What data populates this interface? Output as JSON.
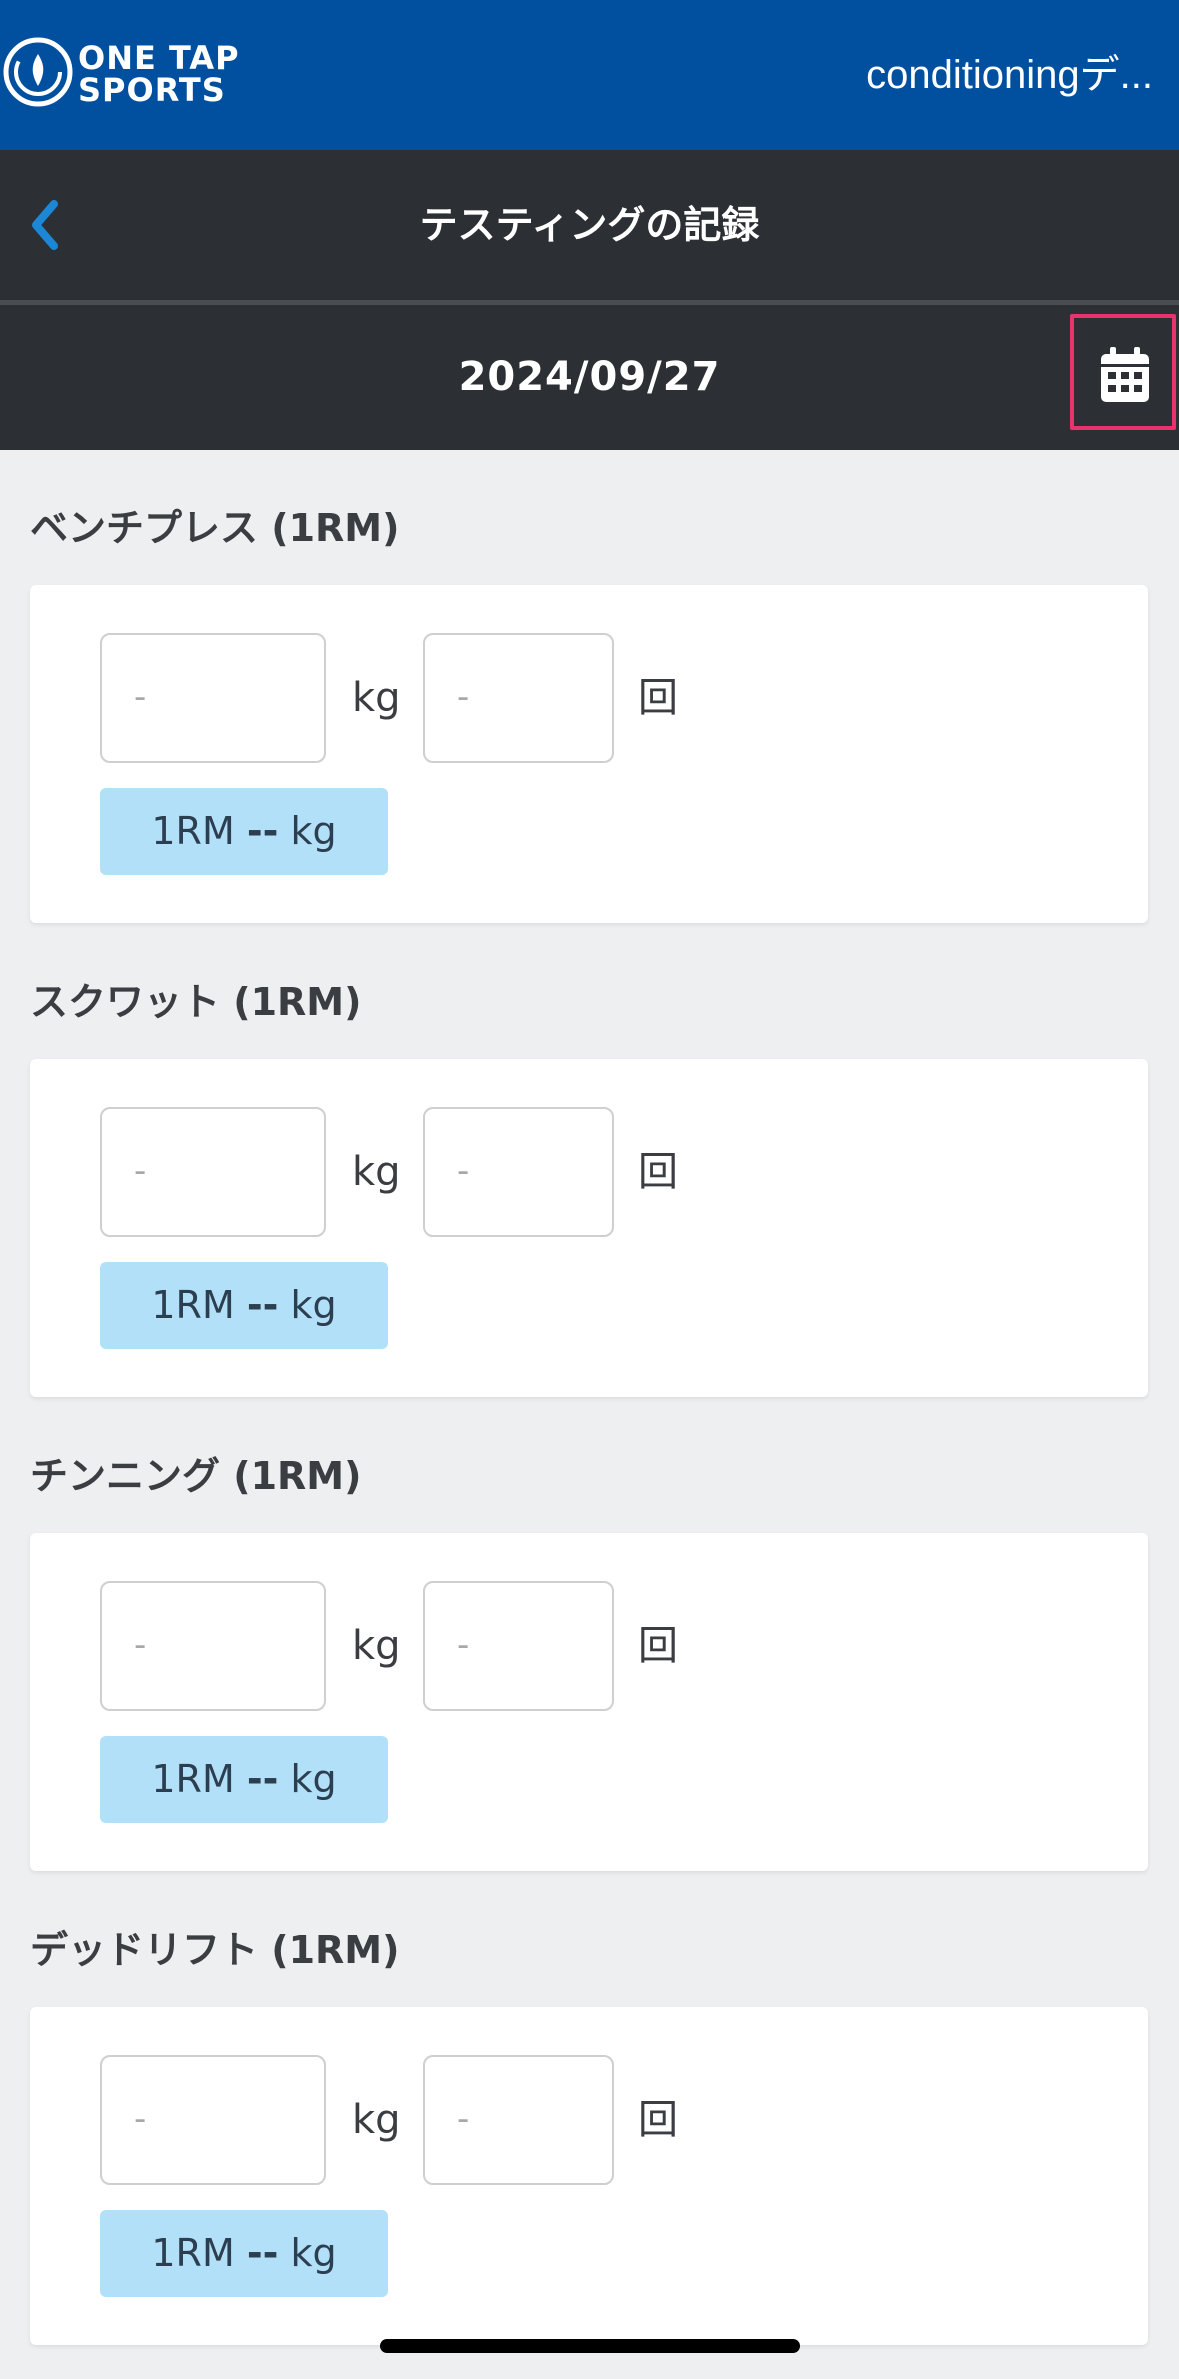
{
  "brand": {
    "logo_text_line1": "ONE TAP",
    "logo_text_line2": "SPORTS",
    "color": "#0150a0"
  },
  "header": {
    "workspace": "conditioningデ...",
    "title": "テスティングの記録",
    "back_icon": "chevron-left-icon"
  },
  "datebar": {
    "date": "2024/09/27",
    "calendar_icon": "calendar-icon",
    "highlight_color": "#e8336d"
  },
  "units": {
    "weight": "kg",
    "reps": "回"
  },
  "placeholders": {
    "weight": "-",
    "reps": "-"
  },
  "result": {
    "prefix": "1RM",
    "value": "--",
    "unit": "kg"
  },
  "sections": [
    {
      "label": "ベンチプレス (1RM)"
    },
    {
      "label": "スクワット (1RM)"
    },
    {
      "label": "チンニング (1RM)"
    },
    {
      "label": "デッドリフト (1RM)"
    }
  ]
}
